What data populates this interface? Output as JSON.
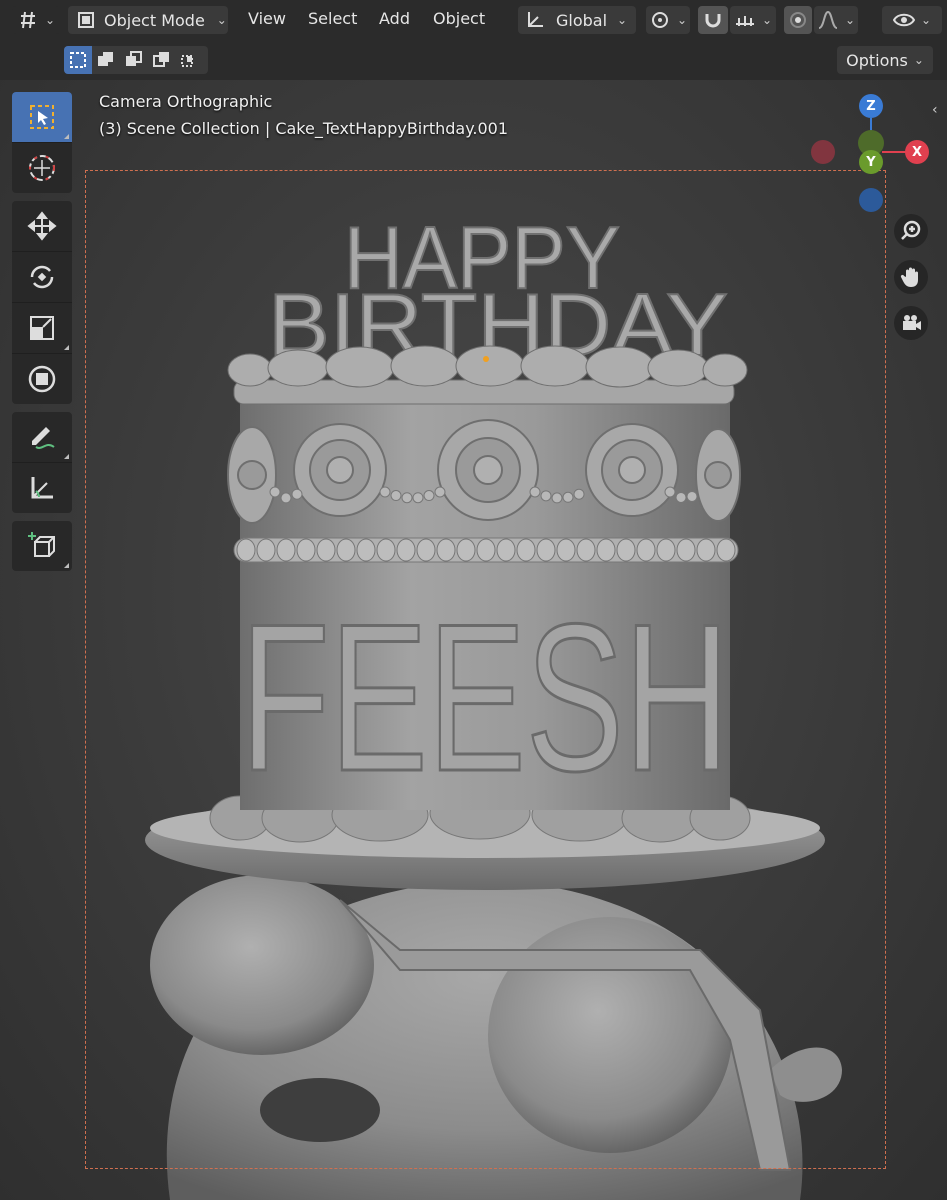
{
  "header": {
    "editor_type_icon": "editor-type-icon",
    "mode_label": "Object Mode",
    "menus": [
      "View",
      "Select",
      "Add",
      "Object"
    ],
    "orientation_label": "Global",
    "options_label": "Options"
  },
  "viewport": {
    "view_name": "Camera Orthographic",
    "object_info": "(3) Scene Collection | Cake_TextHappyBirthday.001"
  },
  "scene": {
    "topper_line1": "HAPPY",
    "topper_line2": "BIRTHDAY",
    "cake_text": "FEESH"
  },
  "gizmo": {
    "z": "Z",
    "y": "Y",
    "x": "X"
  },
  "colors": {
    "accent_blue": "#4772b3",
    "axis_x": "#e0404f",
    "axis_y": "#6a9b2c",
    "axis_z": "#3a7bd5",
    "camera_frame": "#d07050"
  }
}
